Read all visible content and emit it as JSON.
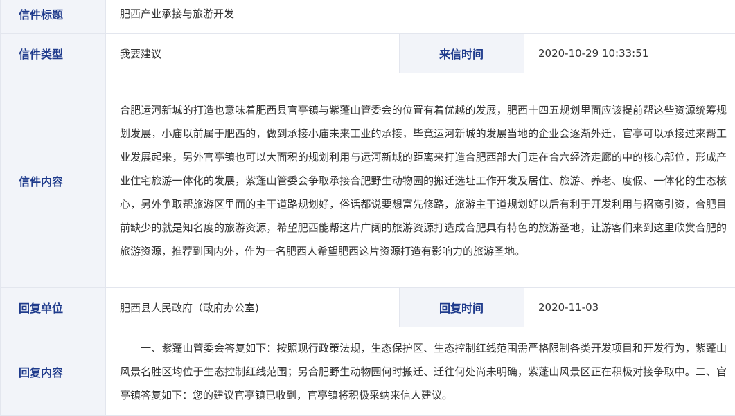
{
  "rows": {
    "title": {
      "label": "信件标题",
      "value": "肥西产业承接与旅游开发"
    },
    "type": {
      "label": "信件类型",
      "value": "我要建议",
      "time_label": "来信时间",
      "time_value": "2020-10-29 10:33:51"
    },
    "content": {
      "label": "信件内容",
      "value": "合肥运河新城的打造也意味着肥西县官亭镇与紫蓬山管委会的位置有着优越的发展，肥西十四五规划里面应该提前帮这些资源统筹规划发展，小庙以前属于肥西的，做到承接小庙未来工业的承接，毕竟运河新城的发展当地的企业会逐渐外迁，官亭可以承接过来帮工业发展起来，另外官亭镇也可以大面积的规划利用与运河新城的距离来打造合肥西部大门走在合六经济走廊的中的核心部位，形成产业住宅旅游一体化的发展，紫蓬山管委会争取承接合肥野生动物园的搬迁选址工作开发及居住、旅游、养老、度假、一体化的生态核心，另外争取帮旅游区里面的主干道路规划好，俗话都说要想富先修路，旅游主干道规划好以后有利于开发利用与招商引资，合肥目前缺少的就是知名度的旅游资源，希望肥西能帮这片广阔的旅游资源打造成合肥具有特色的旅游圣地，让游客们来到这里欣赏合肥的旅游资源，推荐到国内外，作为一名肥西人希望肥西这片资源打造有影响力的旅游圣地。"
    },
    "reply_unit": {
      "label": "回复单位",
      "value": "肥西县人民政府（政府办公室)",
      "time_label": "回复时间",
      "time_value": "2020-11-03"
    },
    "reply_content": {
      "label": "回复内容",
      "value": "一、紫蓬山管委会答复如下：按照现行政策法规，生态保护区、生态控制红线范围需严格限制各类开发项目和开发行为，紫蓬山风景名胜区均位于生态控制红线范围；另合肥野生动物园何时搬迁、迁往何处尚未明确，紫蓬山风景区正在积极对接争取中。二、官亭镇答复如下：您的建议官亭镇已收到，官亭镇将积极采纳来信人建议。"
    }
  }
}
